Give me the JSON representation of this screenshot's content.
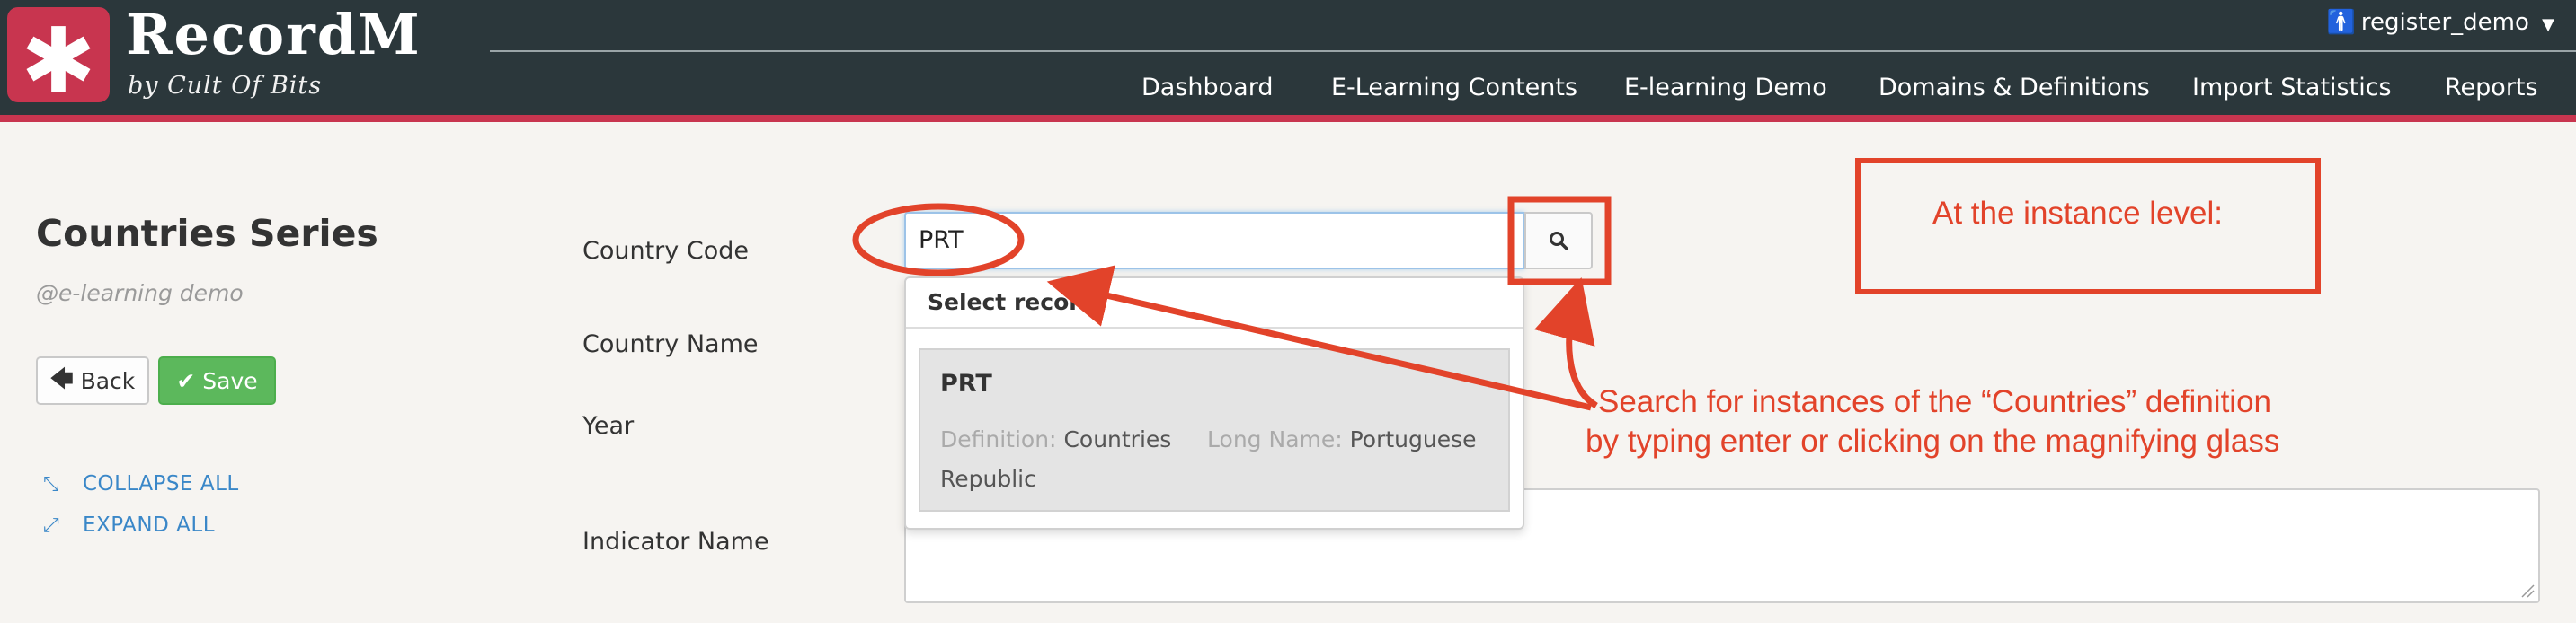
{
  "app": {
    "brand_title": "RecordM",
    "brand_subtitle": "by Cult Of Bits",
    "logo_icon": "asterisk-icon"
  },
  "nav": {
    "items": [
      "Dashboard",
      "E-Learning Contents",
      "E-learning Demo",
      "Domains & Definitions",
      "Import Statistics",
      "Reports"
    ],
    "user": "register_demo"
  },
  "page": {
    "title": "Countries Series",
    "subtitle": "@e-learning demo",
    "back_label": "Back",
    "save_label": "Save",
    "collapse_label": "COLLAPSE ALL",
    "expand_label": "EXPAND ALL"
  },
  "form": {
    "fields": [
      "Country Code",
      "Country Name",
      "Year",
      "Indicator Name"
    ],
    "country_code_value": "PRT"
  },
  "dropdown": {
    "header": "Select record",
    "item": {
      "title": "PRT",
      "definition_key": "Definition:",
      "definition_value": "Countries",
      "longname_key": "Long Name:",
      "longname_value": "Portuguese Republic"
    }
  },
  "annotations": {
    "instance_label": "At the instance level:",
    "search_line1": "Search for instances of the “Countries” definition",
    "search_line2": "by typing enter or clicking on the magnifying glass"
  },
  "colors": {
    "header_bg": "#2b373b",
    "brand_red": "#c8354f",
    "save_green": "#5cb85c",
    "link_blue": "#3a87c8",
    "annotation_red": "#e2432a"
  }
}
